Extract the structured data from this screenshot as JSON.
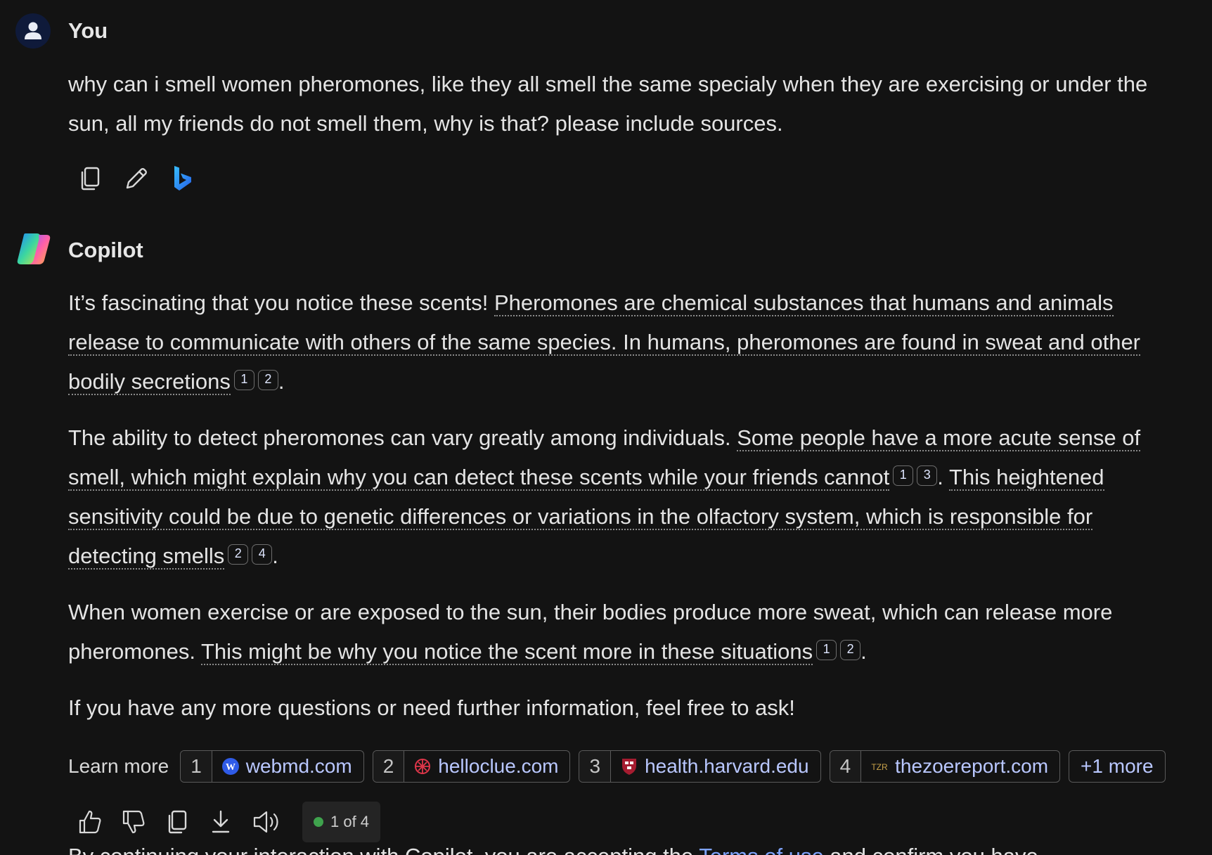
{
  "user": {
    "name": "You",
    "message": "why can i smell women pheromones, like they all smell the same specialy when they are exercising or under the sun, all my friends do not smell them, why is that? please include sources."
  },
  "copilot": {
    "name": "Copilot",
    "p1": {
      "lead": "It’s fascinating that you notice these scents! ",
      "u": "Pheromones are chemical substances that humans and animals release to communicate with others of the same species. In humans, pheromones are found in sweat and other bodily secretions",
      "c1": "1",
      "c2": "2",
      "end": "."
    },
    "p2": {
      "lead": "The ability to detect pheromones can vary greatly among individuals. ",
      "u1": "Some people have a more acute sense of smell, which might explain why you can detect these scents while your friends cannot",
      "c1": "1",
      "c2": "3",
      "mid": ". ",
      "u2": "This heightened sensitivity could be due to genetic differences or variations in the olfactory system, which is responsible for detecting smells",
      "c3": "2",
      "c4": "4",
      "end": "."
    },
    "p3": {
      "lead": "When women exercise or are exposed to the sun, their bodies produce more sweat, which can release more pheromones. ",
      "u": "This might be why you notice the scent more in these situations",
      "c1": "1",
      "c2": "2",
      "end": "."
    },
    "p4": "If you have any more questions or need further information, feel free to ask!"
  },
  "learn_more": {
    "label": "Learn more",
    "sources": [
      {
        "num": "1",
        "domain": "webmd.com",
        "icon": "webmd-icon",
        "icon_text": "W"
      },
      {
        "num": "2",
        "domain": "helloclue.com",
        "icon": "clue-icon"
      },
      {
        "num": "3",
        "domain": "health.harvard.edu",
        "icon": "harvard-shield-icon"
      },
      {
        "num": "4",
        "domain": "thezoereport.com",
        "icon": "tzr-icon",
        "icon_text": "TZR"
      }
    ],
    "more": "+1 more"
  },
  "pager": "1 of 4",
  "footer": {
    "before": "By continuing your interaction with Copilot, you are accepting the ",
    "link": "Terms of use",
    "after": " and confirm you have"
  },
  "colors": {
    "background": "#131313",
    "link": "#b9c7ff",
    "status_dot": "#3fa34d"
  }
}
